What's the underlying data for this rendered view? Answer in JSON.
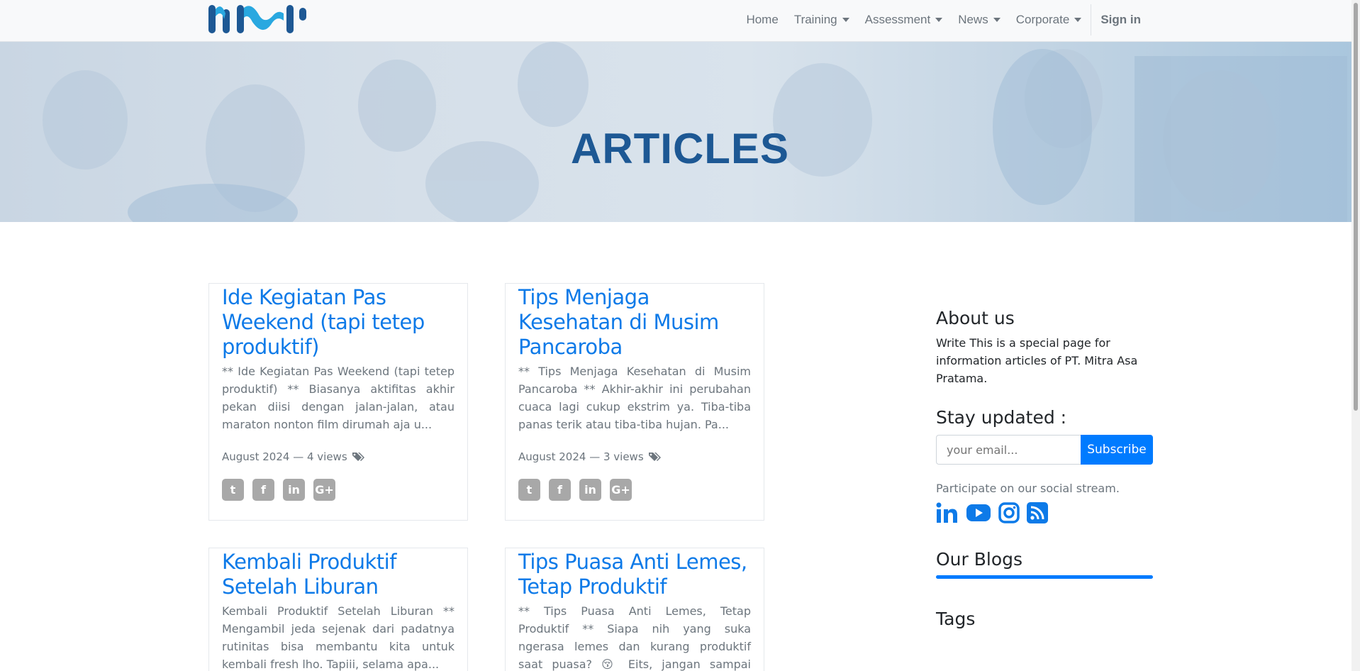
{
  "nav": {
    "items": [
      {
        "label": "Home",
        "dropdown": false
      },
      {
        "label": "Training",
        "dropdown": true
      },
      {
        "label": "Assessment",
        "dropdown": true
      },
      {
        "label": "News",
        "dropdown": true
      },
      {
        "label": "Corporate",
        "dropdown": true
      }
    ],
    "signin": "Sign in"
  },
  "hero": {
    "title": "ARTICLES"
  },
  "articles": [
    {
      "title": "Ide Kegiatan Pas Weekend (tapi tetep produktif)",
      "excerpt": "** Ide Kegiatan Pas Weekend (tapi tetep produktif) ** Biasanya aktifitas akhir pekan diisi dengan jalan-jalan, atau maraton nonton film dirumah aja u...",
      "meta": "August 2024 — 4 views"
    },
    {
      "title": "Tips Menjaga Kesehatan di Musim Pancaroba",
      "excerpt": "** Tips Menjaga Kesehatan di Musim Pancaroba ** Akhir-akhir ini perubahan cuaca lagi cukup ekstrim ya. Tiba-tiba panas terik atau tiba-tiba hujan. Pa...",
      "meta": "August 2024 — 3 views"
    },
    {
      "title": "Kembali Produktif Setelah Liburan",
      "excerpt": "Kembali Produktif Setelah Liburan ** Mengambil jeda sejenak dari padatnya rutinitas bisa membantu kita untuk kembali fresh lho. Tapiii, selama apa...",
      "meta": ""
    },
    {
      "title": "Tips Puasa Anti Lemes, Tetap Produktif",
      "excerpt": "** Tips Puasa Anti Lemes, Tetap Produktif ** Siapa nih yang suka ngerasa lemes dan kurang produktif saat puasa? 😚 Eits, jangan sampai puasa jadi pe...",
      "meta": ""
    }
  ],
  "share_icons": [
    "twitter-icon",
    "facebook-icon",
    "linkedin-icon",
    "google-plus-icon"
  ],
  "sidebar": {
    "about_heading": "About us",
    "about_text": "Write This is a special page for information articles of PT. Mitra Asa Pratama.",
    "stay_heading": "Stay updated :",
    "email_placeholder": "your email...",
    "subscribe_label": "Subscribe",
    "participate": "Participate on our social stream.",
    "social_icons": [
      "linkedin-icon",
      "youtube-icon",
      "instagram-icon",
      "rss-icon"
    ],
    "blogs_heading": "Our Blogs",
    "tags_heading": "Tags"
  },
  "colors": {
    "accent": "#007bff",
    "link": "#0d7ae8",
    "hero_title": "#1d5894",
    "navbar": "#f8f9fa"
  }
}
